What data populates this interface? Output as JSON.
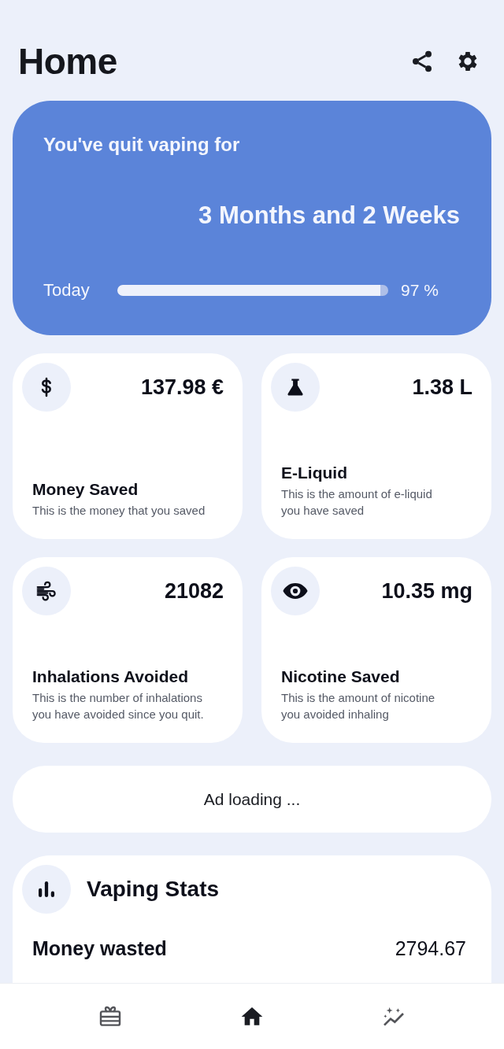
{
  "header": {
    "title": "Home"
  },
  "hero": {
    "label": "You've quit vaping for",
    "duration": "3 Months and 2 Weeks",
    "progress_label": "Today",
    "level": 0.97,
    "reading": "97 %"
  },
  "stats": [
    {
      "value": "137.98 €",
      "title": "Money Saved",
      "description": "This is the money that you saved"
    },
    {
      "value": "1.38 L",
      "title": "E-Liquid",
      "description": "This is the amount of e-liquid you have saved"
    },
    {
      "value": "21082",
      "title": "Inhalations Avoided",
      "description": "This is the number of inhalations you have avoided since you quit."
    },
    {
      "value": "10.35 mg",
      "title": "Nicotine Saved",
      "description": "This is the amount of nicotine you avoided inhaling"
    }
  ],
  "ad": {
    "text": "Ad loading ..."
  },
  "vaping_stats": {
    "title": "Vaping Stats",
    "rows": [
      {
        "label": "Money wasted",
        "value": "2794.67"
      }
    ]
  },
  "bottom_nav": [
    {
      "selected": false
    },
    {
      "selected": true
    },
    {
      "selected": false
    }
  ]
}
